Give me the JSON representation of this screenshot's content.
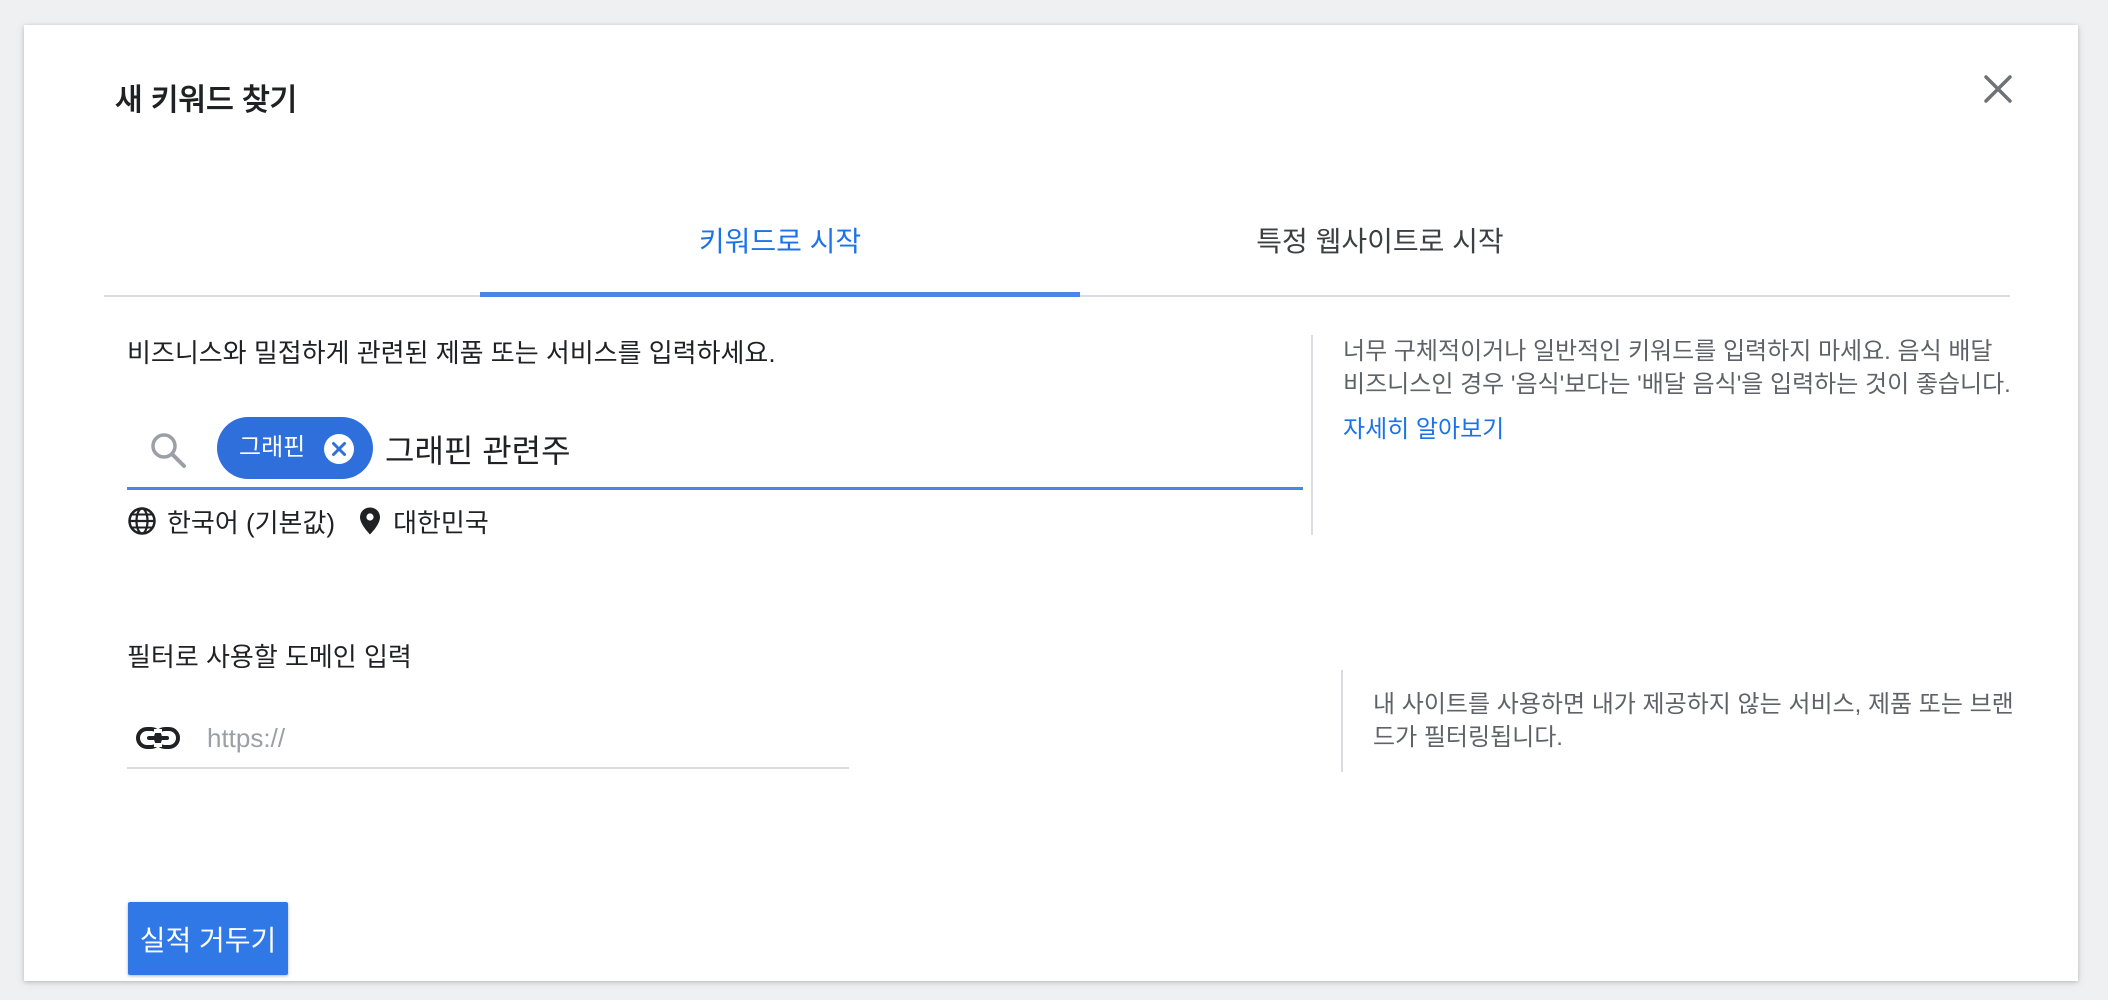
{
  "dialog": {
    "title": "새 키워드 찾기",
    "close_icon": "close-icon"
  },
  "tabs": [
    {
      "label": "키워드로 시작",
      "active": true
    },
    {
      "label": "특정 웹사이트로 시작",
      "active": false
    }
  ],
  "keywords": {
    "label": "비즈니스와 밀접하게 관련된 제품 또는 서비스를 입력하세요.",
    "chips": [
      {
        "label": "그래핀"
      }
    ],
    "input_value": "그래핀 관련주",
    "language": "한국어 (기본값)",
    "location": "대한민국"
  },
  "keyword_tip": {
    "text": "너무 구체적이거나 일반적인 키워드를 입력하지 마세요. 음식 배달 비즈니스인 경우 '음식'보다는 '배달 음식'을 입력하는 것이 좋습니다.",
    "link": "자세히 알아보기"
  },
  "domain": {
    "label": "필터로 사용할 도메인 입력",
    "placeholder": "https://"
  },
  "domain_tip": {
    "text": "내 사이트를 사용하면 내가 제공하지 않는 서비스, 제품 또는 브랜드가 필터링됩니다."
  },
  "actions": {
    "submit_label": "실적 거두기"
  },
  "colors": {
    "accent": "#1a73e8",
    "chip": "#2f6fdc",
    "button": "#2f78e6"
  }
}
